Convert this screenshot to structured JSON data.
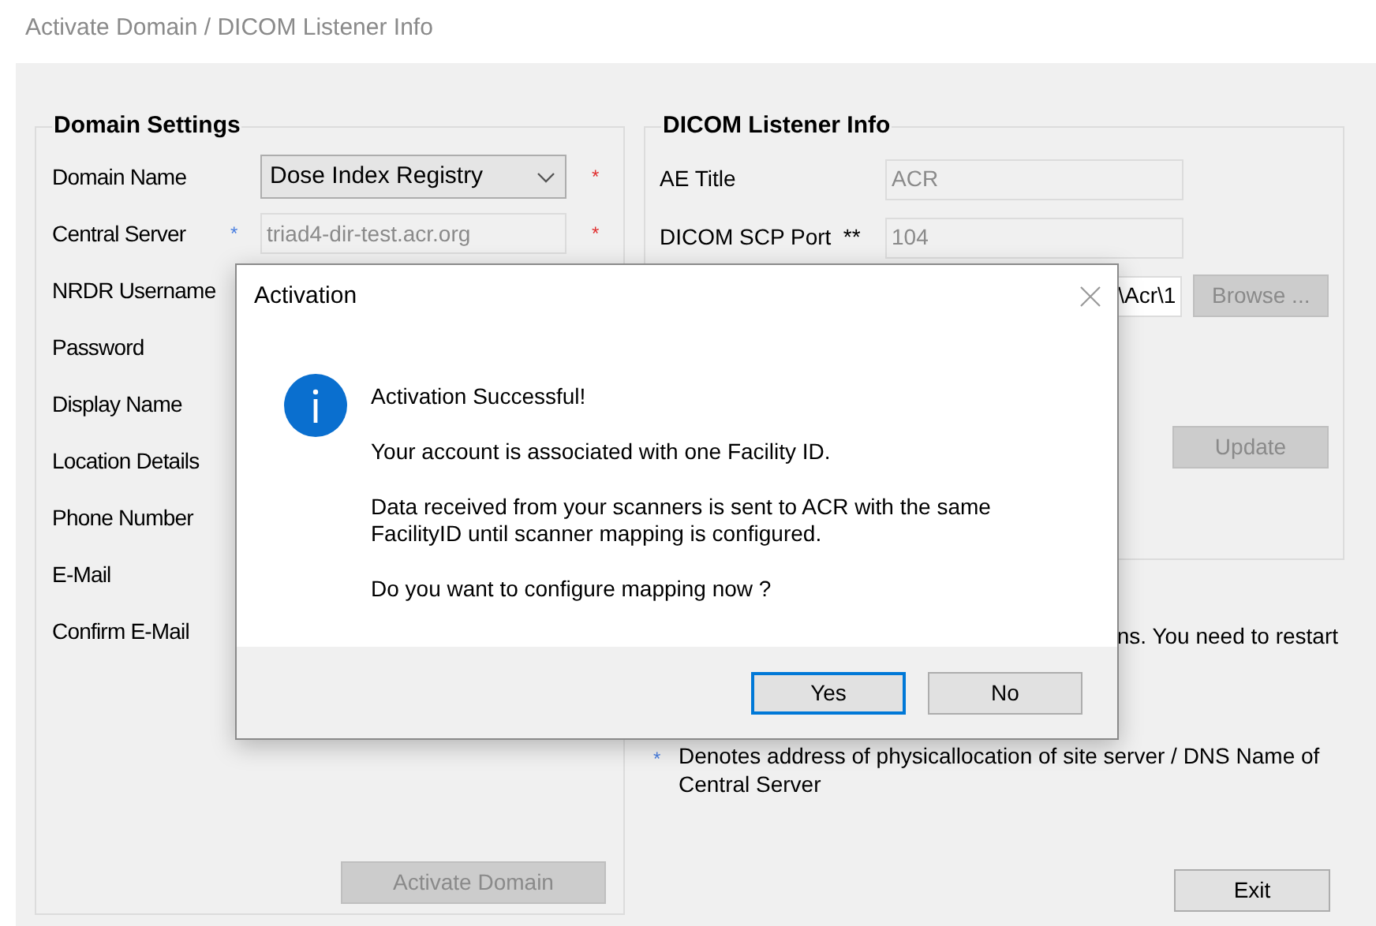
{
  "window": {
    "title": "Activate Domain / DICOM Listener Info"
  },
  "domain_settings": {
    "title": "Domain Settings",
    "rows": [
      {
        "label": "Domain Name",
        "kind": "combo",
        "value": "Dose Index Registry",
        "required_mark": "*"
      },
      {
        "label": "Central Server",
        "kind": "text",
        "value": "triad4-dir-test.acr.org",
        "disabled": true,
        "note_mark": "*",
        "required_mark": "*"
      },
      {
        "label": "NRDR Username",
        "kind": "label"
      },
      {
        "label": "Password",
        "kind": "label"
      },
      {
        "label": "Display Name",
        "kind": "label"
      },
      {
        "label": "Location Details",
        "kind": "label"
      },
      {
        "label": "Phone Number",
        "kind": "label"
      },
      {
        "label": "E-Mail",
        "kind": "label"
      },
      {
        "label": "Confirm E-Mail",
        "kind": "label"
      }
    ],
    "activate_button": {
      "label": "Activate Domain",
      "disabled": true
    }
  },
  "dicom_listener": {
    "title": "DICOM Listener Info",
    "rows": [
      {
        "label": "AE Title",
        "value": "ACR",
        "disabled": true
      },
      {
        "label": "DICOM SCP Port  **",
        "value": "104",
        "disabled": true
      },
      {
        "value": "\\Acr\\1",
        "disabled": false,
        "button": {
          "label": "Browse ...",
          "disabled": true
        }
      }
    ],
    "update_button": {
      "label": "Update",
      "disabled": true
    }
  },
  "restart_note": "ns. You need to restart",
  "footnote_mark": "*",
  "footnote": "Denotes address of physicallocation of site server / DNS Name of Central Server",
  "exit_button": {
    "label": "Exit",
    "disabled": false
  },
  "dialog": {
    "title": "Activation",
    "heading": "Activation Successful!",
    "paragraphs": [
      "Your account is associated with one Facility ID.",
      "Data received from your scanners is sent to ACR with the same FacilityID until scanner mapping is configured.",
      "Do you want to configure mapping now ?"
    ],
    "buttons": [
      {
        "label": "Yes",
        "selected": true
      },
      {
        "label": "No",
        "selected": false
      }
    ]
  }
}
